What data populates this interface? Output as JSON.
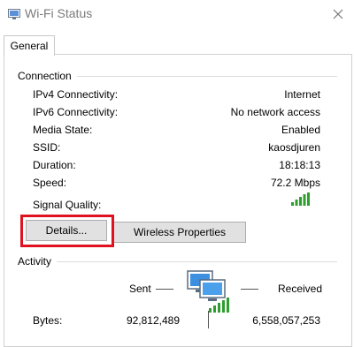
{
  "window": {
    "title": "Wi-Fi Status"
  },
  "tabs": [
    {
      "label": "General"
    }
  ],
  "connection": {
    "heading": "Connection",
    "rows": [
      {
        "label": "IPv4 Connectivity:",
        "value": "Internet"
      },
      {
        "label": "IPv6 Connectivity:",
        "value": "No network access"
      },
      {
        "label": "Media State:",
        "value": "Enabled"
      },
      {
        "label": "SSID:",
        "value": "kaosdjuren"
      },
      {
        "label": "Duration:",
        "value": "18:18:13"
      },
      {
        "label": "Speed:",
        "value": "72.2 Mbps"
      }
    ],
    "signal_quality_label": "Signal Quality:",
    "signal_bars": 5
  },
  "buttons": {
    "details": "Details...",
    "wireless_properties": "Wireless Properties"
  },
  "activity": {
    "heading": "Activity",
    "sent_label": "Sent",
    "received_label": "Received",
    "bytes_label": "Bytes:",
    "bytes_sent": "92,812,489",
    "bytes_received": "6,558,057,253"
  },
  "colors": {
    "highlight": "#e0121f",
    "signal": "#2e9e2e"
  },
  "icons": {
    "app": "wifi-status-icon",
    "close": "close-icon",
    "signal": "signal-strength-icon",
    "network": "network-computers-icon"
  }
}
